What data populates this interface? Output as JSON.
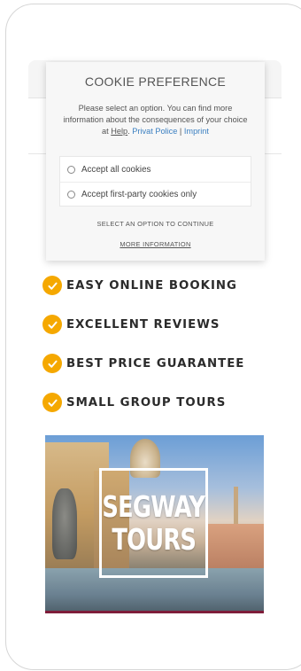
{
  "cookie_modal": {
    "title": "COOKIE PREFERENCE",
    "description_prefix": "Please select an option. You can find more information about the consequences of your choice at ",
    "help_link": "Help",
    "separator_dot": ".",
    "privacy_link": "Privat Police",
    "pipe": "|",
    "imprint_link": "Imprint",
    "options": [
      {
        "label": "Accept all cookies",
        "selected": false
      },
      {
        "label": "Accept first-party cookies only",
        "selected": false
      }
    ],
    "instruction": "SELECT AN OPTION TO CONTINUE",
    "more_info": "MORE INFORMATION"
  },
  "features": [
    {
      "label": "EASY ONLINE BOOKING",
      "icon": "check-circle-icon"
    },
    {
      "label": "EXCELLENT REVIEWS",
      "icon": "check-circle-icon"
    },
    {
      "label": "BEST PRICE GUARANTEE",
      "icon": "check-circle-icon"
    },
    {
      "label": "SMALL GROUP TOURS",
      "icon": "check-circle-icon"
    }
  ],
  "promo": {
    "line1": "SEGWAY",
    "line2": "TOURS"
  },
  "colors": {
    "accent": "#f5a800",
    "link": "#3a7fc1",
    "promo_bar": "#7e1d3a"
  }
}
